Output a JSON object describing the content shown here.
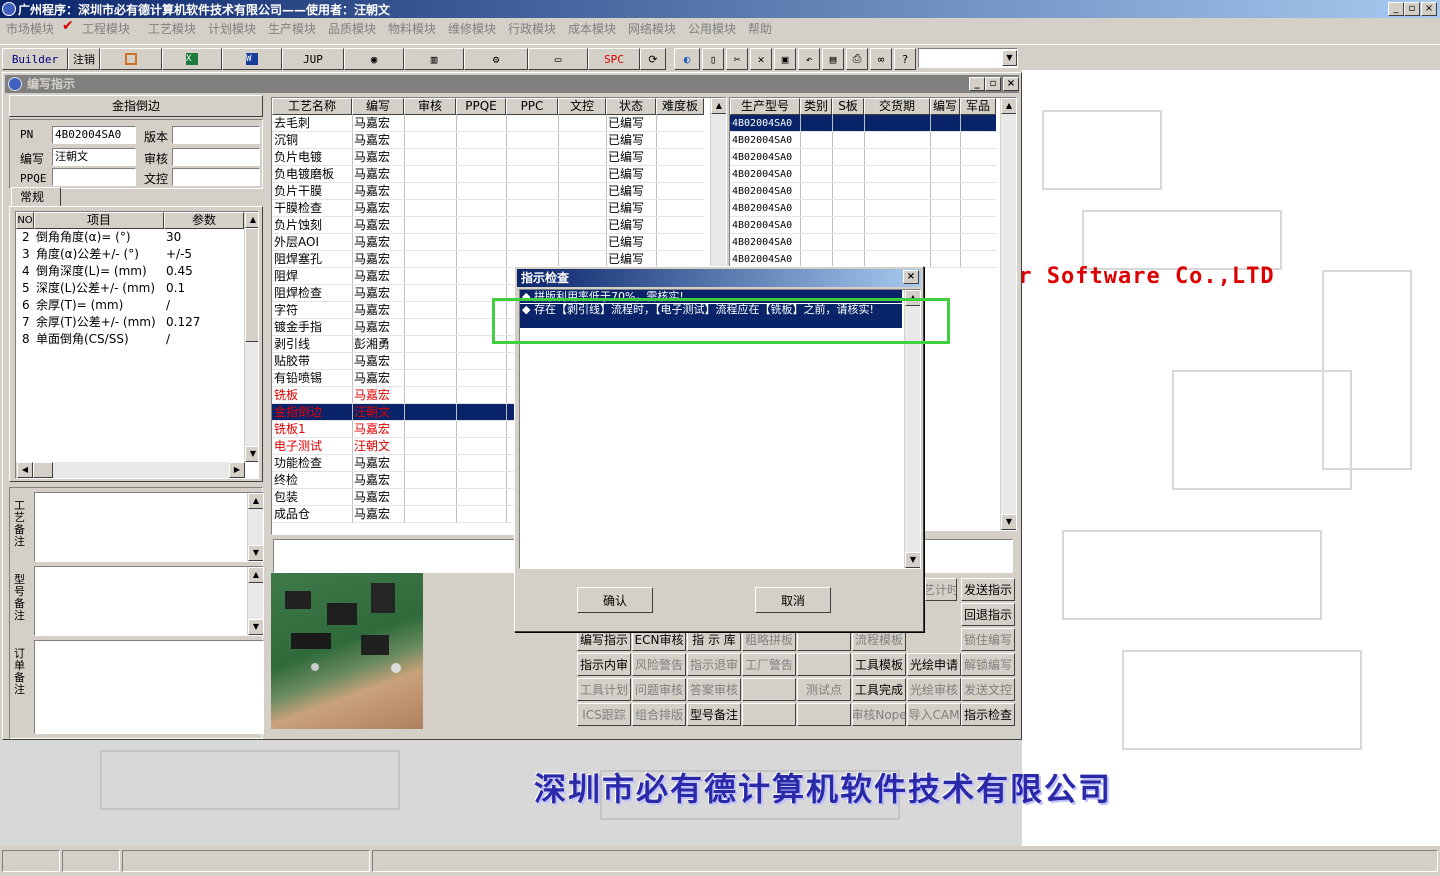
{
  "window": {
    "title": "广州程序：深圳市必有德计算机软件技术有限公司——使用者：汪朝文",
    "controls": [
      "_",
      "▫",
      "×"
    ]
  },
  "menu": [
    "市场模块",
    "工程模块",
    "工艺模块",
    "计划模块",
    "生产模块",
    "品质模块",
    "物料模块",
    "维修模块",
    "行政模块",
    "成本模块",
    "网络模块",
    "公用模块",
    "帮助"
  ],
  "menu_checked": "工程模块",
  "toolbar": {
    "builder": "Builder",
    "zhuxiao": "注销",
    "jup": "JUP",
    "spc": "SPC",
    "dropdown_value": ""
  },
  "child": {
    "title": "编写指示",
    "panel_title": "金指倒边",
    "fields": {
      "pn_label": "PN",
      "pn_value": "4B02004SA0",
      "version_label": "版本",
      "version_value": "",
      "writer_label": "编写",
      "writer_value": "汪朝文",
      "review_label": "审核",
      "review_value": "",
      "ppqe_label": "PPQE",
      "ppqe_value": "",
      "wenkong_label": "文控",
      "wenkong_value": ""
    },
    "tab": "常规",
    "param_headers": [
      "NO",
      "项目",
      "参数"
    ],
    "params": [
      {
        "no": "2",
        "item": "倒角角度(α)=  (°)",
        "value": "30"
      },
      {
        "no": "3",
        "item": "角度(α)公差+/-  (°)",
        "value": "+/-5"
      },
      {
        "no": "4",
        "item": "倒角深度(L)=  (mm)",
        "value": "0.45"
      },
      {
        "no": "5",
        "item": "深度(L)公差+/-  (mm)",
        "value": "0.1"
      },
      {
        "no": "6",
        "item": "余厚(T)=  (mm)",
        "value": "/"
      },
      {
        "no": "7",
        "item": "余厚(T)公差+/-  (mm)",
        "value": "0.127"
      },
      {
        "no": "8",
        "item": "单面倒角(CS/SS)",
        "value": "/"
      }
    ],
    "notes": [
      "工艺备注",
      "型号备注",
      "订单备注"
    ],
    "process_headers": [
      "工艺名称",
      "编写",
      "审核",
      "PPQE",
      "PPC",
      "文控",
      "状态",
      "难度板"
    ],
    "processes": [
      {
        "name": "去毛刺",
        "writer": "马嘉宏",
        "status": "已编写",
        "style": ""
      },
      {
        "name": "沉铜",
        "writer": "马嘉宏",
        "status": "已编写",
        "style": ""
      },
      {
        "name": "负片电镀",
        "writer": "马嘉宏",
        "status": "已编写",
        "style": ""
      },
      {
        "name": "负电镀磨板",
        "writer": "马嘉宏",
        "status": "已编写",
        "style": ""
      },
      {
        "name": "负片干膜",
        "writer": "马嘉宏",
        "status": "已编写",
        "style": ""
      },
      {
        "name": "干膜检查",
        "writer": "马嘉宏",
        "status": "已编写",
        "style": ""
      },
      {
        "name": "负片蚀刻",
        "writer": "马嘉宏",
        "status": "已编写",
        "style": ""
      },
      {
        "name": "外层AOI",
        "writer": "马嘉宏",
        "status": "已编写",
        "style": ""
      },
      {
        "name": "阻焊塞孔",
        "writer": "马嘉宏",
        "status": "已编写",
        "style": ""
      },
      {
        "name": "阻焊",
        "writer": "马嘉宏",
        "status": "",
        "style": ""
      },
      {
        "name": "阻焊检查",
        "writer": "马嘉宏",
        "status": "",
        "style": ""
      },
      {
        "name": "字符",
        "writer": "马嘉宏",
        "status": "",
        "style": ""
      },
      {
        "name": "镀金手指",
        "writer": "马嘉宏",
        "status": "",
        "style": ""
      },
      {
        "name": "剥引线",
        "writer": "彭湘勇",
        "status": "",
        "style": ""
      },
      {
        "name": "贴胶带",
        "writer": "马嘉宏",
        "status": "",
        "style": ""
      },
      {
        "name": "有铅喷锡",
        "writer": "马嘉宏",
        "status": "",
        "style": ""
      },
      {
        "name": "铣板",
        "writer": "马嘉宏",
        "status": "",
        "style": "red"
      },
      {
        "name": "金指倒边",
        "writer": "汪朝文",
        "status": "",
        "style": "sel"
      },
      {
        "name": "铣板1",
        "writer": "马嘉宏",
        "status": "",
        "style": "red"
      },
      {
        "name": "电子测试",
        "writer": "汪朝文",
        "status": "",
        "style": "red"
      },
      {
        "name": "功能检查",
        "writer": "马嘉宏",
        "status": "",
        "style": ""
      },
      {
        "name": "终检",
        "writer": "马嘉宏",
        "status": "",
        "style": ""
      },
      {
        "name": "包装",
        "writer": "马嘉宏",
        "status": "",
        "style": ""
      },
      {
        "name": "成品仓",
        "writer": "马嘉宏",
        "status": "",
        "style": ""
      }
    ],
    "model_headers": [
      "生产型号",
      "类别",
      "S板",
      "交货期",
      "编写",
      "军品"
    ],
    "models": [
      "4B02004SA0",
      "4B02004SA0",
      "4B02004SA0",
      "4B02004SA0",
      "4B02004SA0",
      "4B02004SA0",
      "4B02004SA0",
      "4B02004SA0",
      "4B02004SA0"
    ],
    "buttons": [
      [
        "编写指示",
        "ECN审核",
        "指 示 库",
        "粗略拼板",
        "",
        "流程模板",
        "",
        "锁住编写"
      ],
      [
        "指示内审",
        "风险警告",
        "指示退审",
        "工厂警告",
        "",
        "工具模板",
        "光绘申请",
        "解锁编写"
      ],
      [
        "工具计划",
        "问题审核",
        "答案审核",
        "",
        "测试点",
        "工具完成",
        "光绘审核",
        "发送文控"
      ],
      [
        "ICS跟踪",
        "组合排版",
        "型号备注",
        "",
        "",
        "审核Nope",
        "导入CAM",
        "指示检查"
      ]
    ],
    "buttons_disabled": [
      [
        false,
        false,
        false,
        true,
        false,
        true,
        false,
        true
      ],
      [
        false,
        true,
        true,
        true,
        false,
        false,
        false,
        true
      ],
      [
        true,
        true,
        true,
        false,
        true,
        false,
        true,
        true
      ],
      [
        true,
        true,
        false,
        false,
        false,
        true,
        true,
        false
      ]
    ],
    "side_buttons": [
      "发送指示",
      "回退指示"
    ],
    "side_partial": "艺计时"
  },
  "dialog": {
    "title": "指示检查",
    "messages": [
      "拼版利用率低于70%，需核实!",
      "存在【剥引线】流程时，【电子测试】流程应在【铣板】之前，请核实!"
    ],
    "ok": "确认",
    "cancel": "取消"
  },
  "background": {
    "brand": "er Software Co.,LTD",
    "company": "深圳市必有德计算机软件技术有限公司"
  },
  "colors": {
    "titlebar": "#0a246a",
    "selection": "#0a246a",
    "highlight": "#3fcf3f",
    "red": "#e00000",
    "brand_red": "#d00000",
    "company_blue": "#2a2aa8"
  }
}
